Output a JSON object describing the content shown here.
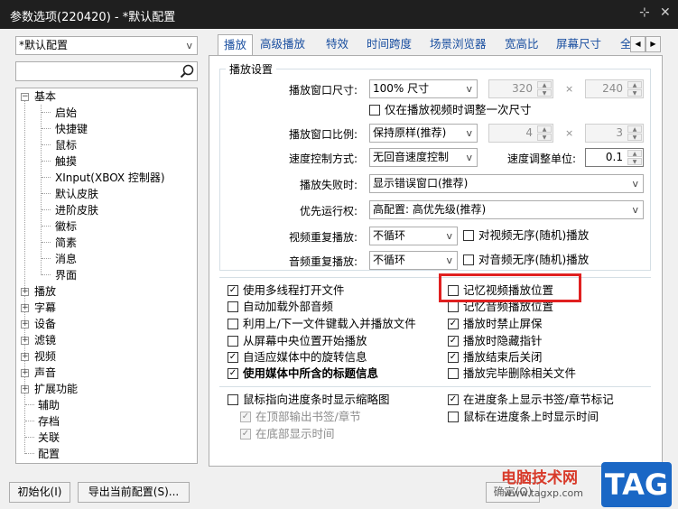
{
  "window": {
    "title": "参数选项(220420) - *默认配置",
    "pin_icon": "pin-icon",
    "close_icon": "close-icon"
  },
  "sidebar": {
    "profile_select": "*默认配置",
    "search_placeholder": "",
    "tree": [
      {
        "label": "基本",
        "expanded": true
      },
      {
        "label": "启始"
      },
      {
        "label": "快捷键"
      },
      {
        "label": "鼠标"
      },
      {
        "label": "触摸"
      },
      {
        "label": "XInput(XBOX 控制器)"
      },
      {
        "label": "默认皮肤"
      },
      {
        "label": "进阶皮肤"
      },
      {
        "label": "徽标"
      },
      {
        "label": "简素"
      },
      {
        "label": "消息"
      },
      {
        "label": "界面"
      },
      {
        "label": "播放",
        "expanded": false
      },
      {
        "label": "字幕",
        "expanded": false
      },
      {
        "label": "设备",
        "expanded": false
      },
      {
        "label": "滤镜",
        "expanded": false
      },
      {
        "label": "视频",
        "expanded": false
      },
      {
        "label": "声音",
        "expanded": false
      },
      {
        "label": "扩展功能",
        "expanded": false
      },
      {
        "label": "辅助"
      },
      {
        "label": "存档"
      },
      {
        "label": "关联"
      },
      {
        "label": "配置"
      }
    ]
  },
  "tabs": [
    "播放",
    "高级播放",
    "特效",
    "时间跨度",
    "场景浏览器",
    "宽高比",
    "屏幕尺寸",
    "全"
  ],
  "playback": {
    "group_title": "播放设置",
    "window_size_label": "播放窗口尺寸:",
    "window_size_value": "100% 尺寸",
    "width_value": "320",
    "height_value": "240",
    "times_sign": "×",
    "only_once_label": "仅在播放视频时调整一次尺寸",
    "aspect_label": "播放窗口比例:",
    "aspect_value": "保持原样(推荐)",
    "aspect_w": "4",
    "aspect_h": "3",
    "speed_mode_label": "速度控制方式:",
    "speed_mode_value": "无回音速度控制",
    "speed_unit_label": "速度调整单位:",
    "speed_unit_value": "0.1",
    "fail_label": "播放失败时:",
    "fail_value": "显示错误窗口(推荐)",
    "priority_label": "优先运行权:",
    "priority_value": "高配置: 高优先级(推荐)",
    "video_repeat_label": "视频重复播放:",
    "video_repeat_value": "不循环",
    "video_shuffle_label": "对视频无序(随机)播放",
    "audio_repeat_label": "音频重复播放:",
    "audio_repeat_value": "不循环",
    "audio_shuffle_label": "对音频无序(随机)播放"
  },
  "options_left": [
    {
      "label": "使用多线程打开文件",
      "checked": true
    },
    {
      "label": "自动加载外部音频",
      "checked": false
    },
    {
      "label": "利用上/下一文件键载入并播放文件",
      "checked": false
    },
    {
      "label": "从屏幕中央位置开始播放",
      "checked": false
    },
    {
      "label": "自适应媒体中的旋转信息",
      "checked": true
    },
    {
      "label": "使用媒体中所含的标题信息",
      "checked": true
    }
  ],
  "options_right": [
    {
      "label": "记忆视频播放位置",
      "checked": false
    },
    {
      "label": "记忆音频播放位置",
      "checked": false
    },
    {
      "label": "播放时禁止屏保",
      "checked": true
    },
    {
      "label": "播放时隐藏指针",
      "checked": true
    },
    {
      "label": "播放结束后关闭",
      "checked": true
    },
    {
      "label": "播放完毕删除相关文件",
      "checked": false
    }
  ],
  "seek": {
    "thumb_label": "鼠标指向进度条时显示缩略图",
    "top_bookmark_label": "在顶部输出书签/章节",
    "bottom_time_label": "在底部显示时间",
    "show_marks_label": "在进度条上显示书签/章节标记",
    "hover_time_label": "鼠标在进度条上时显示时间"
  },
  "footer": {
    "reset_label": "初始化(I)",
    "export_label": "导出当前配置(S)...",
    "ok_label": "确定(O)"
  },
  "watermark": {
    "site_name": "电脑技术网",
    "site_url": "www.tagxp.com",
    "tag_text": "TAG"
  },
  "colors": {
    "highlight": "#e02020",
    "tab_text": "#1a4fa0",
    "titlebar": "#1f1f1f"
  }
}
